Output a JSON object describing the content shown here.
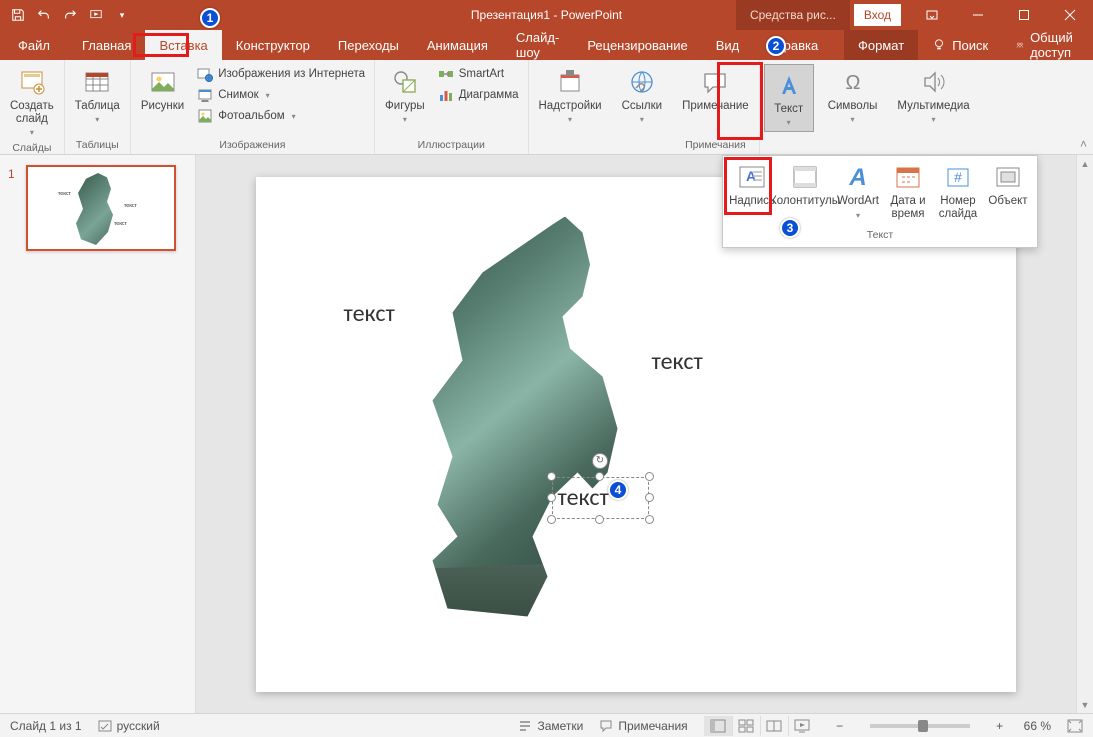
{
  "title": "Презентация1 - PowerPoint",
  "context_tab": "Средства рис...",
  "signin": "Вход",
  "tabs": {
    "file": "Файл",
    "home": "Главная",
    "insert": "Вставка",
    "design": "Конструктор",
    "transitions": "Переходы",
    "animation": "Анимация",
    "slideshow": "Слайд-шоу",
    "review": "Рецензирование",
    "view": "Вид",
    "help": "Справка",
    "format": "Формат",
    "search": "Поиск",
    "share": "Общий доступ"
  },
  "ribbon": {
    "slides": {
      "new_slide": "Создать\nслайд",
      "group": "Слайды"
    },
    "tables": {
      "table": "Таблица",
      "group": "Таблицы"
    },
    "images": {
      "pictures": "Рисунки",
      "online_pics": "Изображения из Интернета",
      "screenshot": "Снимок",
      "album": "Фотоальбом",
      "group": "Изображения"
    },
    "illustrations": {
      "shapes": "Фигуры",
      "smartart": "SmartArt",
      "chart": "Диаграмма",
      "group": "Иллюстрации"
    },
    "addins": {
      "addins": "Надстройки"
    },
    "links": {
      "links": "Ссылки"
    },
    "comments": {
      "comment": "Примечание",
      "group": "Примечания"
    },
    "text": {
      "text": "Текст"
    },
    "symbols": {
      "symbols": "Символы"
    },
    "media": {
      "media": "Мультимедиа"
    }
  },
  "text_dropdown": {
    "textbox": "Надпись",
    "header_footer": "Колонтитулы",
    "wordart": "WordArt",
    "date_time": "Дата и\nвремя",
    "slide_number": "Номер\nслайда",
    "object": "Объект",
    "group": "Текст"
  },
  "thumbnail": {
    "num": "1"
  },
  "slide_texts": {
    "t1": "текст",
    "t2": "текст",
    "t3": "текст"
  },
  "statusbar": {
    "slide_pos": "Слайд 1 из 1",
    "lang": "русский",
    "notes": "Заметки",
    "comments": "Примечания",
    "zoom": "66 %"
  },
  "annotations": {
    "n1": "1",
    "n2": "2",
    "n3": "3",
    "n4": "4"
  }
}
